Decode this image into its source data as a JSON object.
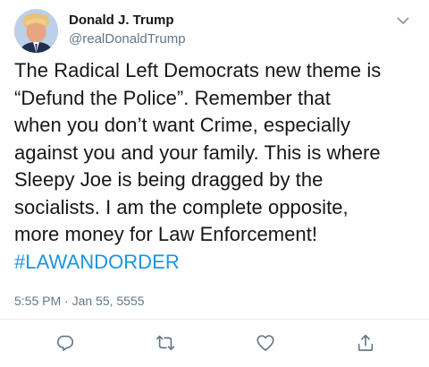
{
  "tweet": {
    "author": {
      "display_name": "Donald J. Trump",
      "handle": "@realDonaldTrump",
      "avatar_icon": "profile-photo"
    },
    "body_line1": "The Radical Left Democrats new theme is\n“Defund the Police”. Remember that\nwhen you don’t want Crime, especially\nagainst you and your family. This is where\nSleepy Joe is being dragged by the\nsocialists. I am the complete opposite,\nmore money for Law Enforcement!",
    "hashtag": "#LAWANDORDER",
    "timestamp": "5:55 PM · Jan 55, 5555"
  },
  "actions": [
    {
      "icon": "reply-icon"
    },
    {
      "icon": "retweet-icon"
    },
    {
      "icon": "like-icon"
    },
    {
      "icon": "share-icon"
    }
  ],
  "colors": {
    "text": "#14171a",
    "secondary": "#657786",
    "link": "#1b95e0",
    "divider": "#e6ecf0",
    "icon": "#657786"
  }
}
